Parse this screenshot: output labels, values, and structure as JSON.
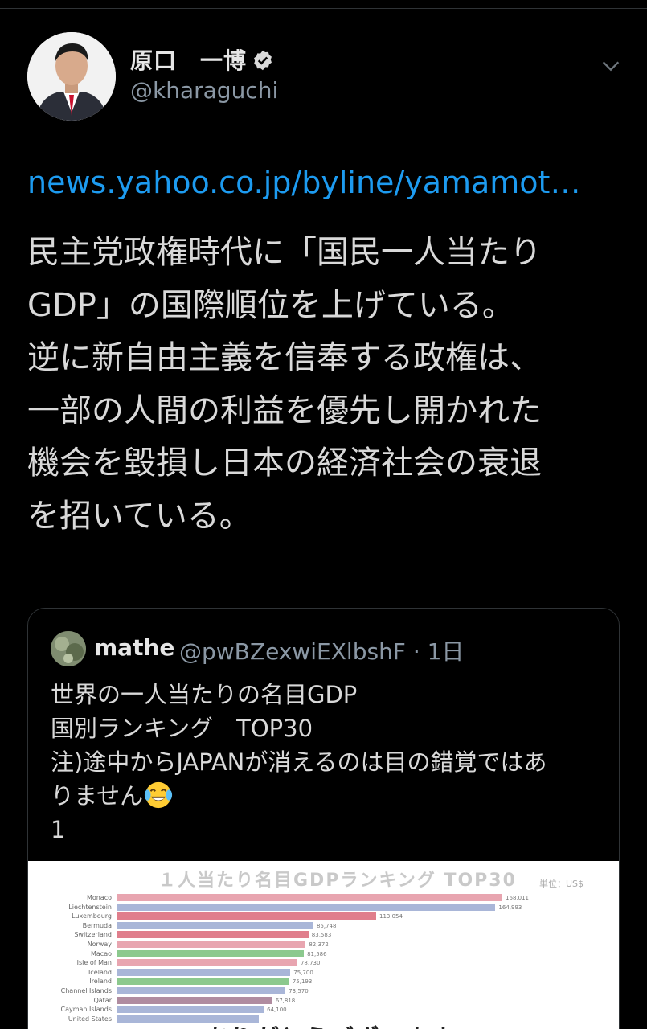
{
  "tweet": {
    "author_name": "原口　一博",
    "author_handle": "@kharaguchi",
    "link": "news.yahoo.co.jp/byline/yamamot…",
    "text": "民主党政権時代に「国民一人当たり\nGDP」の国際順位を上げている。\n逆に新自由主義を信奉する政権は、\n一部の人間の利益を優先し開かれた\n機会を毀損し日本の経済社会の衰退\nを招いている。"
  },
  "quote": {
    "author_name": "mathe",
    "author_handle": "@pwBZexwiEXlbshF · 1日",
    "text_lines": [
      "世界の一人当たりの名目GDP",
      "国別ランキング　TOP30",
      "注)途中からJAPANが消えるのは目の錯覚ではあ",
      "りません"
    ],
    "emoji": "face-with-tears-of-joy-icon",
    "trailing_text": "1"
  },
  "chart_data": {
    "type": "bar",
    "title": "１人当たり名目GDPランキング TOP30",
    "unit": "単位：US$",
    "categories": [
      "Monaco",
      "Liechtenstein",
      "Luxembourg",
      "Bermuda",
      "Switzerland",
      "Norway",
      "Macao",
      "Isle of Man",
      "Iceland",
      "Ireland",
      "Channel Islands",
      "Qatar",
      "Cayman Islands",
      "United States"
    ],
    "values": [
      168011,
      164993,
      113054,
      85748,
      83583,
      82372,
      81586,
      78730,
      75700,
      75193,
      73570,
      67818,
      64100,
      62000
    ],
    "value_labels": [
      "168,011",
      "164,993",
      "113,054",
      "85,748",
      "83,583",
      "82,372",
      "81,586",
      "78,730",
      "75,700",
      "75,193",
      "73,570",
      "67,818",
      "64,100",
      ""
    ],
    "colors": [
      "#e8a5b0",
      "#a9b6d8",
      "#e07e8c",
      "#a9b6d8",
      "#e07e8c",
      "#e8a5b0",
      "#8cc98e",
      "#e8a5b0",
      "#a9b6d8",
      "#8cc98e",
      "#a9b6d8",
      "#b08ca0",
      "#a9b6d8",
      "#a9b6d8"
    ],
    "xlim": [
      0,
      175000
    ],
    "overlay_caption": "ありがとうございます"
  },
  "colors": {
    "background": "#000000",
    "link": "#1d9bf0",
    "secondary": "#8b98a5",
    "verified": "#d9d9d9"
  }
}
